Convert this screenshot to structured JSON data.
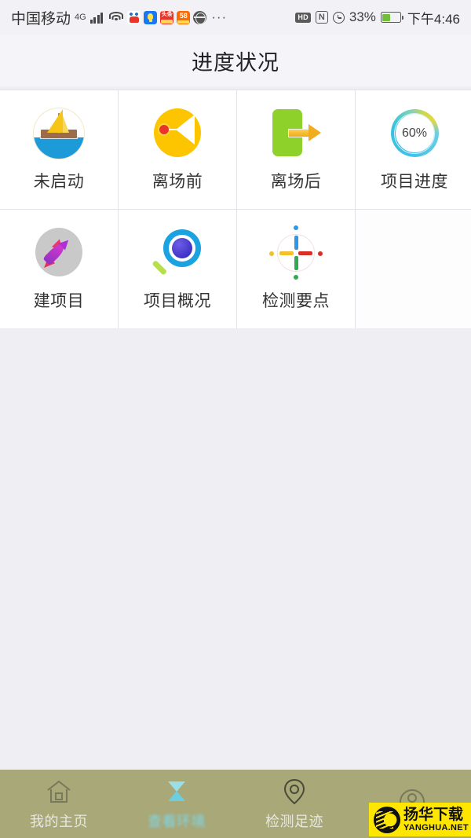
{
  "status_bar": {
    "carrier": "中国移动",
    "network_generation": "4G",
    "icons": [
      "signal-bars",
      "wifi-icon",
      "baidu-app-icon",
      "bulb-app-icon",
      "toutiao-app-icon",
      "58-app-icon",
      "browser-globe-icon",
      "more-dots-icon"
    ],
    "more_dots": "···",
    "hd_badge": "HD",
    "nfc_badge": "N",
    "alarm_icon": "alarm-clock-icon",
    "battery_percent": "33%",
    "time": "下午4:46"
  },
  "header": {
    "title": "进度状况"
  },
  "grid": {
    "items": [
      {
        "label": "未启动",
        "icon": "sailboat-icon"
      },
      {
        "label": "离场前",
        "icon": "megaphone-left-icon"
      },
      {
        "label": "离场后",
        "icon": "exit-door-arrow-icon"
      },
      {
        "label": "项目进度",
        "icon": "progress-ring-icon",
        "value": "60%"
      },
      {
        "label": "建项目",
        "icon": "rocket-icon"
      },
      {
        "label": "项目概况",
        "icon": "magnifier-icon"
      },
      {
        "label": "检测要点",
        "icon": "crosshair-icon"
      },
      {
        "label": "",
        "icon": ""
      }
    ]
  },
  "bottom_nav": {
    "items": [
      {
        "label": "我的主页",
        "icon": "home-icon",
        "active": false
      },
      {
        "label": "查看环境",
        "icon": "hourglass-icon",
        "active": true
      },
      {
        "label": "检测足迹",
        "icon": "map-pin-icon",
        "active": false
      },
      {
        "label": "",
        "icon": "user-avatar-icon",
        "active": false
      }
    ]
  },
  "watermark": {
    "cn": "扬华下载",
    "en": "YANGHUA.NET"
  },
  "colors": {
    "page_background": "#efeef3",
    "card_background": "#ffffff",
    "nav_background": "#a8a878",
    "nav_active": "#7fd8ea",
    "accent_yellow": "#fdc500",
    "accent_green": "#8ed12a",
    "accent_blue": "#1aa3e0",
    "watermark_yellow": "#ffe600"
  }
}
